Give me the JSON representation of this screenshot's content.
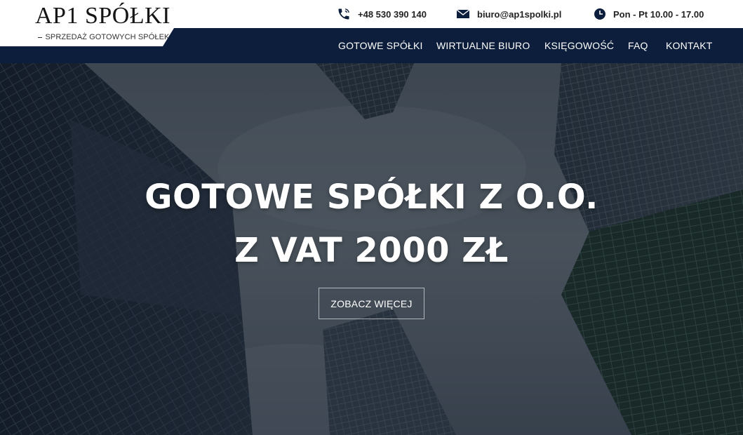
{
  "logo": {
    "title": "AP1 SPÓŁKI",
    "subtitle": "SPRZEDAŻ GOTOWYCH SPÓŁEK"
  },
  "contacts": {
    "phone": {
      "icon": "phone-icon",
      "text": "+48 530 390 140"
    },
    "email": {
      "icon": "envelope-icon",
      "text": "biuro@ap1spolki.pl"
    },
    "hours": {
      "icon": "clock-icon",
      "text": "Pon - Pt 10.00 - 17.00"
    }
  },
  "nav": {
    "items": [
      {
        "label": "GOTOWE SPÓŁKI"
      },
      {
        "label": "WIRTUALNE BIURO"
      },
      {
        "label": "KSIĘGOWOŚĆ"
      },
      {
        "label": "FAQ"
      },
      {
        "label": "KONTAKT"
      }
    ]
  },
  "hero": {
    "line1": "GOTOWE SPÓŁKI Z O.O.",
    "line2": "Z VAT 2000 ZŁ",
    "cta": "ZOBACZ WIĘCEJ"
  },
  "colors": {
    "navy": "#0c1e3b",
    "white": "#ffffff",
    "text_dark": "#222222"
  }
}
